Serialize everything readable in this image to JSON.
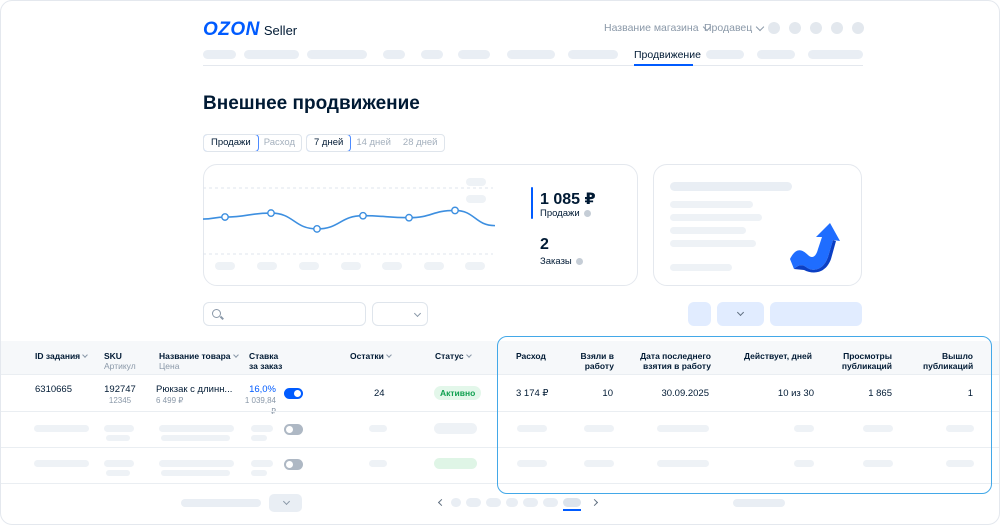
{
  "header": {
    "logo_brand": "OZON",
    "logo_product": "Seller",
    "store_menu": "Название магазина",
    "user_menu": "Продавец"
  },
  "nav": {
    "active_tab": "Продвижение"
  },
  "page_title": "Внешнее продвижение",
  "metric_toggle": {
    "options": [
      "Продажи",
      "Расход"
    ],
    "selected": "Продажи"
  },
  "period_toggle": {
    "options": [
      "7 дней",
      "14 дней",
      "28 дней"
    ],
    "selected": "7 дней"
  },
  "stats": {
    "sales_value": "1 085 ₽",
    "sales_label": "Продажи",
    "orders_value": "2",
    "orders_label": "Заказы"
  },
  "chart_data": {
    "type": "line",
    "title": "",
    "xlabel": "",
    "ylabel": "",
    "series": [
      {
        "values": [
          0.56,
          0.62,
          0.38,
          0.58,
          0.55,
          0.66
        ]
      }
    ],
    "accent": "#3d8fe0"
  },
  "table": {
    "columns": [
      {
        "title": "ID задания",
        "sub": ""
      },
      {
        "title": "SKU",
        "sub": "Артикул"
      },
      {
        "title": "Название товара",
        "sub": "Цена"
      },
      {
        "title": "Ставка за заказ",
        "sub": ""
      },
      {
        "title": "Остатки",
        "sub": ""
      },
      {
        "title": "Статус",
        "sub": ""
      },
      {
        "title": "Расход",
        "sub": ""
      },
      {
        "title": "Взяли в работу",
        "sub": ""
      },
      {
        "title": "Дата последнего взятия в работу",
        "sub": ""
      },
      {
        "title": "Действует, дней",
        "sub": ""
      },
      {
        "title": "Просмотры публикаций",
        "sub": ""
      },
      {
        "title": "Вышло публикаций",
        "sub": ""
      }
    ],
    "rows": [
      {
        "id": "6310665",
        "sku": "192747",
        "article": "12345",
        "name": "Рюкзак с длинн...",
        "price": "6 499 ₽",
        "rate": "16,0%",
        "rate_sum": "1 039,84 ₽",
        "toggle_on": true,
        "stock": "24",
        "status": "Активно",
        "spend": "3 174 ₽",
        "taken": "10",
        "last_date": "30.09.2025",
        "active_days": "10 из 30",
        "views": "1 865",
        "publications": "1"
      }
    ]
  },
  "colors": {
    "accent": "#005bff",
    "highlight": "#43a8e8",
    "status_green": "#10a050"
  }
}
